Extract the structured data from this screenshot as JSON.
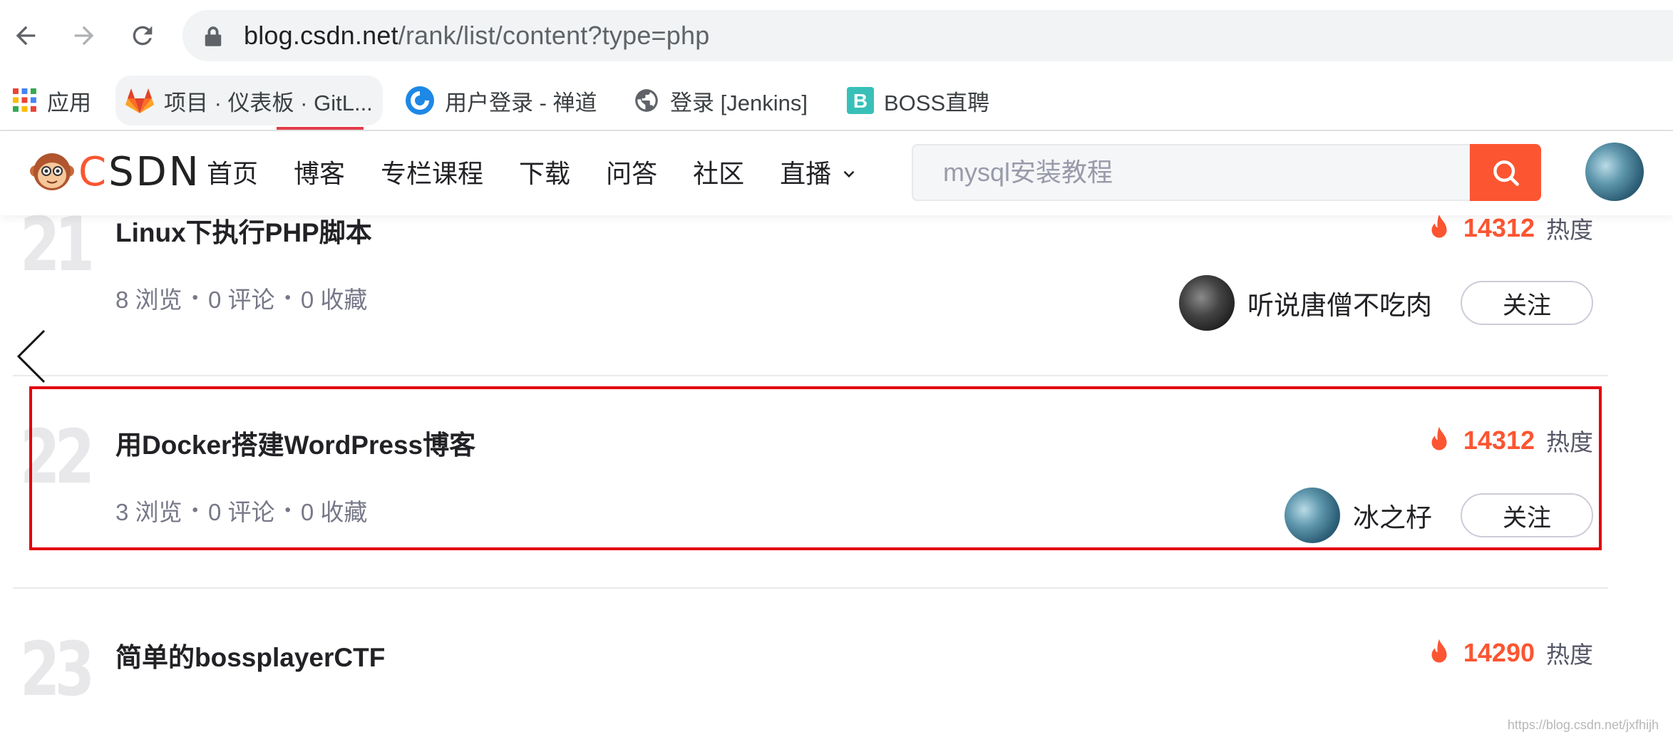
{
  "browser": {
    "url_domain": "blog.csdn.net",
    "url_path": "/rank/list/content?type=php",
    "bookmarks": [
      {
        "label": "应用",
        "icon": "apps-grid-icon"
      },
      {
        "label": "项目 · 仪表板 · GitL...",
        "icon": "gitlab-icon"
      },
      {
        "label": "用户登录 - 禅道",
        "icon": "zentao-icon"
      },
      {
        "label": "登录 [Jenkins]",
        "icon": "globe-icon"
      },
      {
        "label": "BOSS直聘",
        "icon": "boss-icon"
      }
    ]
  },
  "header": {
    "logo_text": "CSDN",
    "nav": [
      "首页",
      "博客",
      "专栏课程",
      "下载",
      "问答",
      "社区",
      "直播"
    ],
    "search_placeholder": "mysql安装教程",
    "colors": {
      "accent": "#fc5531"
    }
  },
  "list": {
    "items": [
      {
        "rank": "21",
        "title": "Linux下执行PHP脚本",
        "views": "8 浏览",
        "comments": "0 评论",
        "favorites": "0 收藏",
        "heat_value": "14312",
        "heat_label": "热度",
        "author": "听说唐僧不吃肉",
        "follow_label": "关注"
      },
      {
        "rank": "22",
        "title": "用Docker搭建WordPress博客",
        "views": "3 浏览",
        "comments": "0 评论",
        "favorites": "0 收藏",
        "heat_value": "14312",
        "heat_label": "热度",
        "author": "冰之杍",
        "follow_label": "关注"
      },
      {
        "rank": "23",
        "title": "简单的bossplayerCTF",
        "heat_value": "14290",
        "heat_label": "热度"
      }
    ]
  },
  "watermark": "https://blog.csdn.net/jxfhijh"
}
